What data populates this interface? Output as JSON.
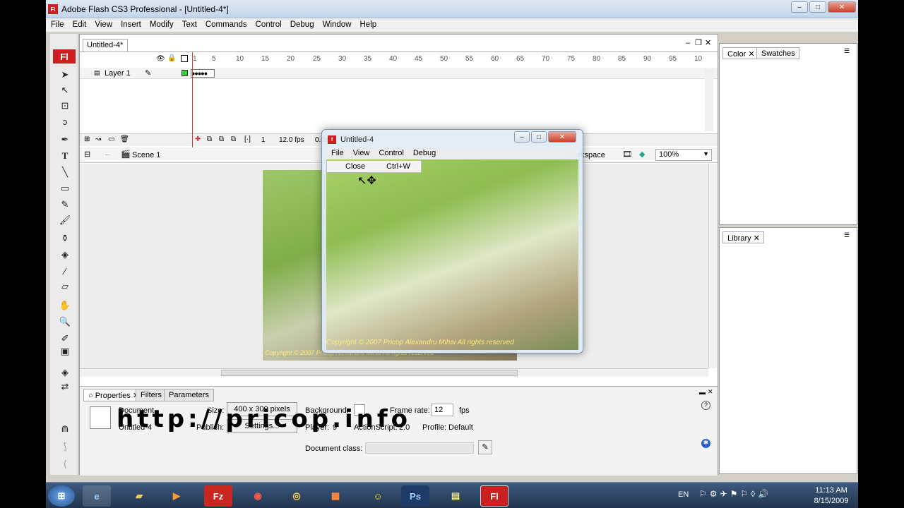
{
  "window": {
    "title": "Adobe Flash CS3 Professional - [Untitled-4*]",
    "logo": "Fl"
  },
  "menu": [
    "File",
    "Edit",
    "View",
    "Insert",
    "Modify",
    "Text",
    "Commands",
    "Control",
    "Debug",
    "Window",
    "Help"
  ],
  "document": {
    "tab_label": "Untitled-4*",
    "ruler_ticks": [
      "1",
      "5",
      "10",
      "15",
      "20",
      "25",
      "30",
      "35",
      "40",
      "45",
      "50",
      "55",
      "60",
      "65",
      "70",
      "75",
      "80",
      "85",
      "90",
      "95",
      "10"
    ],
    "layer_name": "Layer 1",
    "timeline_status": {
      "frame": "1",
      "fps": "12.0 fps",
      "time": "0.0s"
    },
    "scene": "Scene 1",
    "workspace_label": "Workspace",
    "zoom": "100%",
    "stage_caption": "Copyright © 2007 Pricop Alexandru Mihai All rights reserved"
  },
  "properties": {
    "tabs": [
      "Properties",
      "Filters",
      "Parameters"
    ],
    "doc_type": "Document",
    "doc_name": "Untitled-4",
    "size_label": "Size:",
    "size_value": "400 x 300 pixels",
    "background_label": "Background:",
    "frame_rate_label": "Frame rate:",
    "frame_rate_value": "12",
    "fps": "fps",
    "publish_label": "Publish:",
    "settings_button": "Settings...",
    "player_label": "Player:",
    "player_value": "9",
    "actionscript_label": "ActionScript:",
    "actionscript_value": "2.0",
    "profile_label": "Profile:",
    "profile_value": "Default",
    "document_class_label": "Document class:",
    "document_class_value": ""
  },
  "right_panels": {
    "color_tabs": [
      "Color",
      "Swatches"
    ],
    "library_tab": "Library"
  },
  "swf_window": {
    "title": "Untitled-4",
    "menu": [
      "File",
      "View",
      "Control",
      "Debug"
    ],
    "dropdown": {
      "item": "Close",
      "shortcut": "Ctrl+W"
    },
    "caption": "Copyright © 2007 Pricop Alexandru Mihai All rights reserved"
  },
  "watermark": "http://pricop.info",
  "taskbar": {
    "language": "EN",
    "time": "11:13 AM",
    "date": "8/15/2009",
    "apps": [
      "start",
      "internet-explorer",
      "explorer",
      "media-player",
      "filezilla",
      "app-red",
      "chrome",
      "app-blocks",
      "yahoo-messenger",
      "photoshop",
      "notes",
      "flash"
    ]
  },
  "colors": {
    "flash_red": "#cc1f1f",
    "playhead": "#d73b3b",
    "taskbar": "#20344e"
  }
}
